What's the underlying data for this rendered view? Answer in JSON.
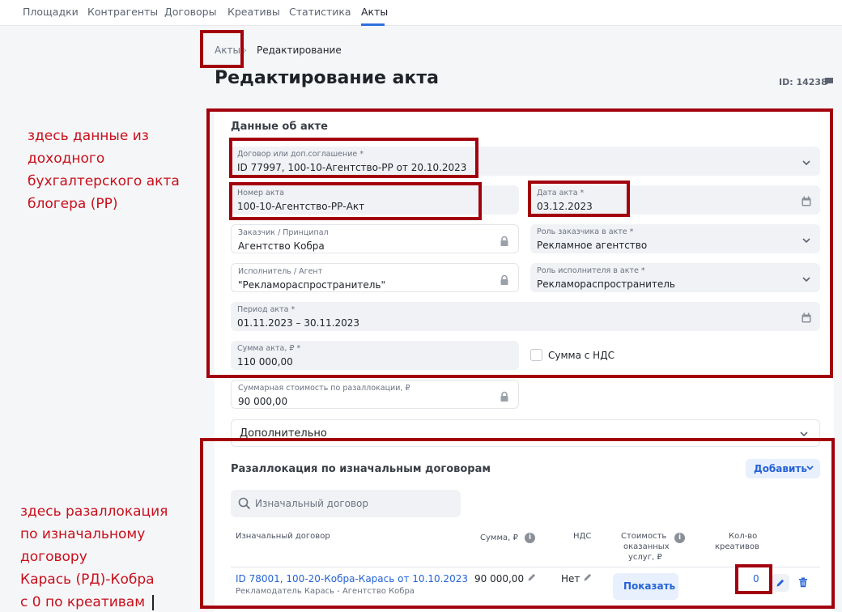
{
  "nav": {
    "items": [
      "Площадки",
      "Контрагенты",
      "Договоры",
      "Креативы",
      "Статистика",
      "Акты"
    ],
    "active": "Акты",
    "accent": "#2f6fde"
  },
  "breadcrumb": {
    "parent": "Акты",
    "current": "Редактирование"
  },
  "page": {
    "title": "Редактирование акта",
    "id_label": "ID: 14238"
  },
  "act_section": {
    "title": "Данные об акте",
    "contract": {
      "label": "Договор или доп.соглашение *",
      "value": "ID 77997, 100-10-Агентство-РР от 20.10.2023"
    },
    "act_number": {
      "label": "Номер акта",
      "value": "100-10-Агентство-РР-Акт"
    },
    "act_date": {
      "label": "Дата акта *",
      "value": "03.12.2023"
    },
    "customer": {
      "label": "Заказчик / Принципал",
      "value": "Агентство Кобра"
    },
    "customer_role": {
      "label": "Роль заказчика в акте *",
      "value": "Рекламное агентство"
    },
    "executor": {
      "label": "Исполнитель / Агент",
      "value": "\"Рекламораспространитель\""
    },
    "executor_role": {
      "label": "Роль исполнителя в акте *",
      "value": "Рекламораспространитель"
    },
    "period": {
      "label": "Период акта *",
      "value": "01.11.2023 – 30.11.2023"
    },
    "amount": {
      "label": "Сумма акта, ₽ *",
      "value": "110 000,00"
    },
    "vat_checkbox": "Сумма с НДС",
    "realloc_total": {
      "label": "Суммарная стоимость по разаллокации, ₽",
      "value": "90 000,00"
    },
    "extra": "Дополнительно"
  },
  "realloc_section": {
    "title": "Разаллокация по изначальным договорам",
    "add_button": "Добавить",
    "search_placeholder": "Изначальный договор",
    "columns": {
      "contract": "Изначальный договор",
      "sum": "Сумма, ₽",
      "vat": "НДС",
      "cost_1": "Стоимость",
      "cost_2": "оказанных",
      "cost_3": "услуг, ₽",
      "count_1": "Кол-во",
      "count_2": "креативов"
    },
    "rows": [
      {
        "contract": "ID 78001, 100-20-Кобра-Карась от 10.10.2023",
        "parties": "Рекламодатель Карась - Агентство Кобра",
        "sum": "90 000,00",
        "vat": "Нет",
        "show_button": "Показать",
        "creatives": "0"
      }
    ]
  },
  "annotations": {
    "note1": [
      "здесь данные из",
      "доходного",
      "бухгалтерского акта",
      "блогера (РР)"
    ],
    "note2": [
      "здесь разаллокация",
      "по изначальному",
      "договору",
      "Карась (РД)-Кобра",
      "с 0 по креативам"
    ],
    "color": "#a3000d"
  }
}
